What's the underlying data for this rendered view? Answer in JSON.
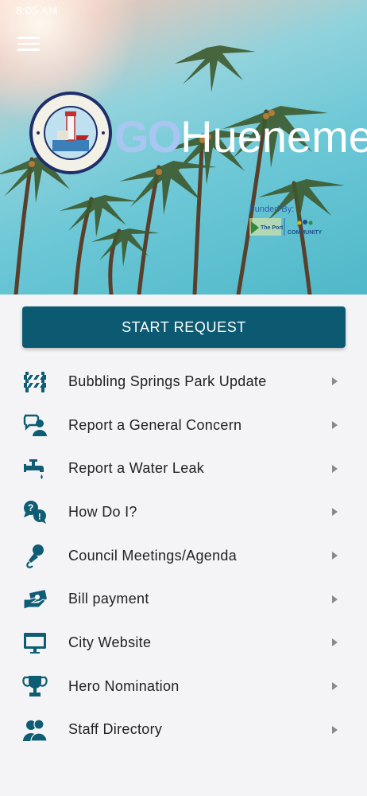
{
  "status_bar": {
    "time": "8:05 AM"
  },
  "header": {
    "menu_icon": "hamburger-menu-icon",
    "brand_go": "GO",
    "brand_name": "Hueneme",
    "seal_text": "CITY OF PORT HUENEME · VENTURA COUNTY",
    "funded_by": "Funded By:",
    "sponsor_1": "The Port",
    "sponsor_2": "COMMUNITY"
  },
  "start_button": {
    "label": "START REQUEST",
    "color": "#0b5a72"
  },
  "menu": {
    "items": [
      {
        "label": "Bubbling Springs Park Update",
        "icon": "barricade-icon"
      },
      {
        "label": "Report a General Concern",
        "icon": "person-speech-icon"
      },
      {
        "label": "Report a Water Leak",
        "icon": "faucet-icon"
      },
      {
        "label": "How Do I?",
        "icon": "question-bubbles-icon"
      },
      {
        "label": "Council Meetings/Agenda",
        "icon": "microphone-icon"
      },
      {
        "label": "Bill payment",
        "icon": "hand-money-icon"
      },
      {
        "label": "City Website",
        "icon": "monitor-icon"
      },
      {
        "label": "Hero Nomination",
        "icon": "trophy-icon"
      },
      {
        "label": "Staff Directory",
        "icon": "staff-group-icon"
      }
    ]
  },
  "colors": {
    "accent": "#0b5a72",
    "icon": "#0f5d74",
    "text": "#222222",
    "background": "#f4f4f6"
  }
}
